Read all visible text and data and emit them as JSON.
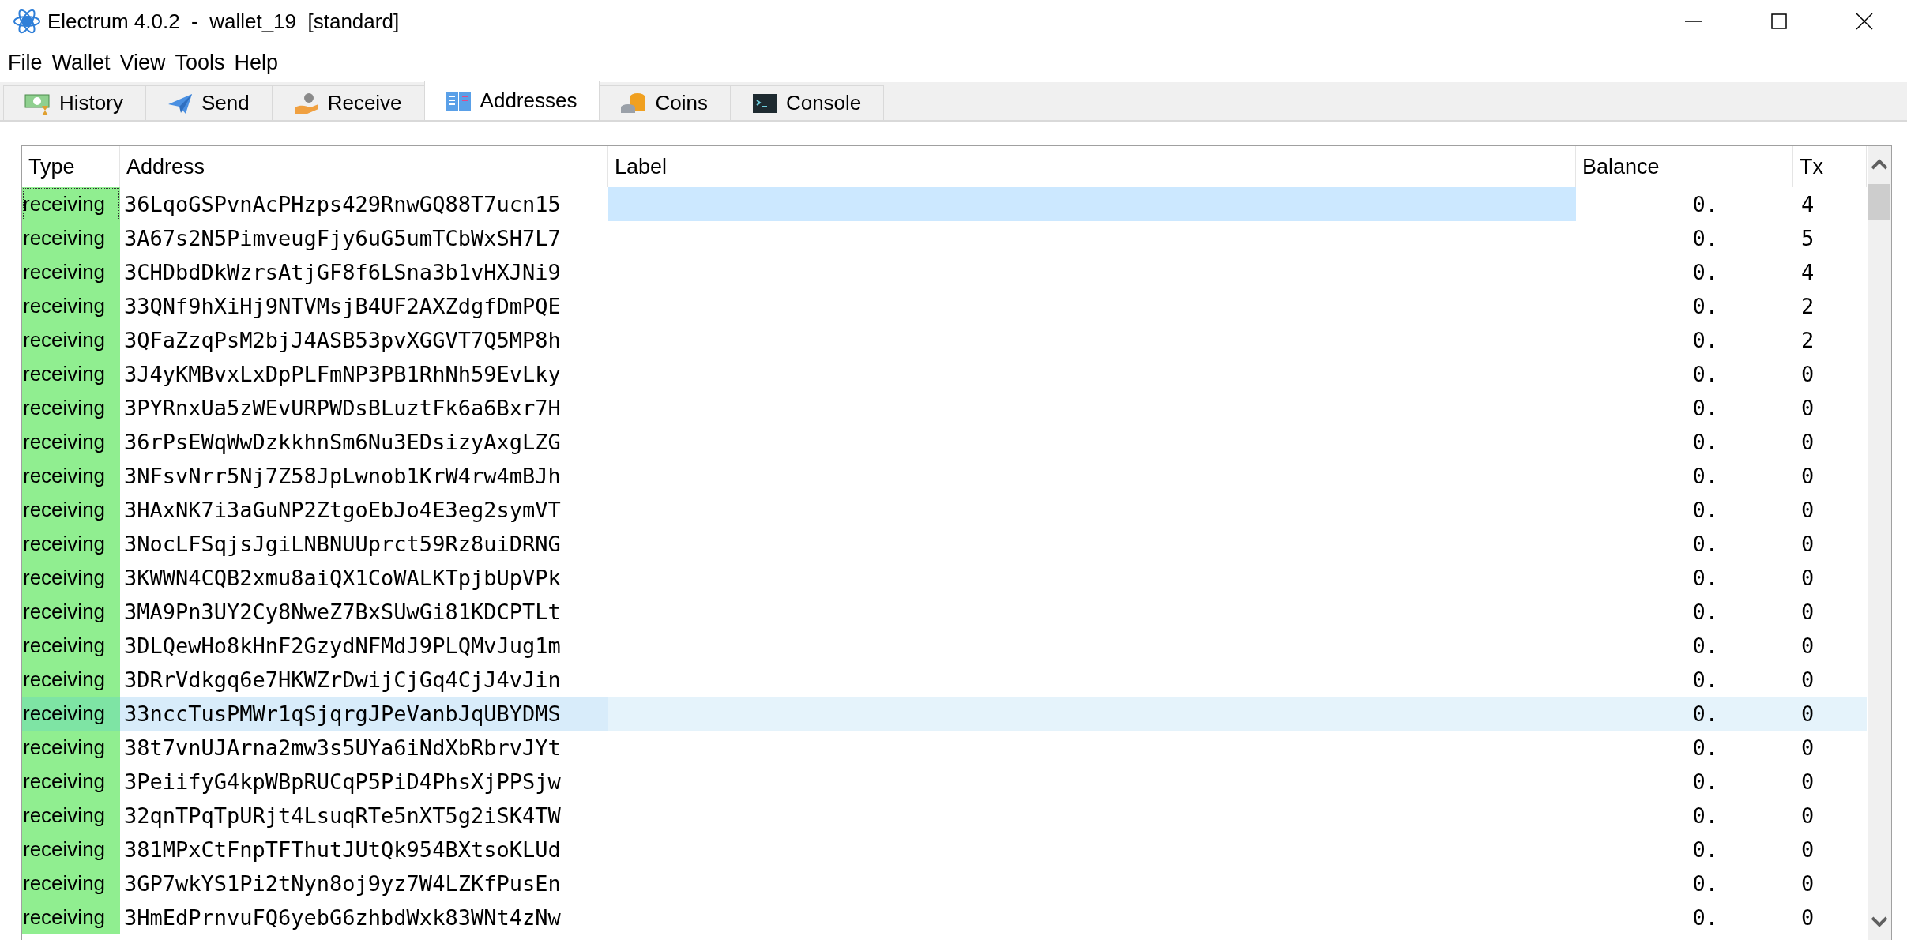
{
  "window": {
    "title": "Electrum 4.0.2  -  wallet_19  [standard]"
  },
  "menu": [
    "File",
    "Wallet",
    "View",
    "Tools",
    "Help"
  ],
  "tabs": [
    {
      "label": "History",
      "selected": false
    },
    {
      "label": "Send",
      "selected": false
    },
    {
      "label": "Receive",
      "selected": false
    },
    {
      "label": "Addresses",
      "selected": true
    },
    {
      "label": "Coins",
      "selected": false
    },
    {
      "label": "Console",
      "selected": false
    }
  ],
  "table": {
    "columns": [
      "Type",
      "Address",
      "Label",
      "Balance",
      "Tx"
    ],
    "rows": [
      {
        "type": "receiving",
        "address": "36LqoGSPvnAcPHzps429RnwGQ88T7ucn15",
        "balance": "0.",
        "tx": "4",
        "selected": true,
        "hovered": false
      },
      {
        "type": "receiving",
        "address": "3A67s2N5PimveugFjy6uG5umTCbWxSH7L7",
        "balance": "0.",
        "tx": "5",
        "selected": false,
        "hovered": false
      },
      {
        "type": "receiving",
        "address": "3CHDbdDkWzrsAtjGF8f6LSna3b1vHXJNi9",
        "balance": "0.",
        "tx": "4",
        "selected": false,
        "hovered": false
      },
      {
        "type": "receiving",
        "address": "33QNf9hXiHj9NTVMsjB4UF2AXZdgfDmPQE",
        "balance": "0.",
        "tx": "2",
        "selected": false,
        "hovered": false
      },
      {
        "type": "receiving",
        "address": "3QFaZzqPsM2bjJ4ASB53pvXGGVT7Q5MP8h",
        "balance": "0.",
        "tx": "2",
        "selected": false,
        "hovered": false
      },
      {
        "type": "receiving",
        "address": "3J4yKMBvxLxDpPLFmNP3PB1RhNh59EvLky",
        "balance": "0.",
        "tx": "0",
        "selected": false,
        "hovered": false
      },
      {
        "type": "receiving",
        "address": "3PYRnxUa5zWEvURPWDsBLuztFk6a6Bxr7H",
        "balance": "0.",
        "tx": "0",
        "selected": false,
        "hovered": false
      },
      {
        "type": "receiving",
        "address": "36rPsEWqWwDzkkhnSm6Nu3EDsizyAxgLZG",
        "balance": "0.",
        "tx": "0",
        "selected": false,
        "hovered": false
      },
      {
        "type": "receiving",
        "address": "3NFsvNrr5Nj7Z58JpLwnob1KrW4rw4mBJh",
        "balance": "0.",
        "tx": "0",
        "selected": false,
        "hovered": false
      },
      {
        "type": "receiving",
        "address": "3HAxNK7i3aGuNP2ZtgoEbJo4E3eg2symVT",
        "balance": "0.",
        "tx": "0",
        "selected": false,
        "hovered": false
      },
      {
        "type": "receiving",
        "address": "3NocLFSqjsJgiLNBNUUprct59Rz8uiDRNG",
        "balance": "0.",
        "tx": "0",
        "selected": false,
        "hovered": false
      },
      {
        "type": "receiving",
        "address": "3KWWN4CQB2xmu8aiQX1CoWALKTpjbUpVPk",
        "balance": "0.",
        "tx": "0",
        "selected": false,
        "hovered": false
      },
      {
        "type": "receiving",
        "address": "3MA9Pn3UY2Cy8NweZ7BxSUwGi81KDCPTLt",
        "balance": "0.",
        "tx": "0",
        "selected": false,
        "hovered": false
      },
      {
        "type": "receiving",
        "address": "3DLQewHo8kHnF2GzydNFMdJ9PLQMvJug1m",
        "balance": "0.",
        "tx": "0",
        "selected": false,
        "hovered": false
      },
      {
        "type": "receiving",
        "address": "3DRrVdkgq6e7HKWZrDwijCjGq4CjJ4vJin",
        "balance": "0.",
        "tx": "0",
        "selected": false,
        "hovered": false
      },
      {
        "type": "receiving",
        "address": "33nccTusPMWr1qSjqrgJPeVanbJqUBYDMS",
        "balance": "0.",
        "tx": "0",
        "selected": false,
        "hovered": true
      },
      {
        "type": "receiving",
        "address": "38t7vnUJArna2mw3s5UYa6iNdXbRbrvJYt",
        "balance": "0.",
        "tx": "0",
        "selected": false,
        "hovered": false
      },
      {
        "type": "receiving",
        "address": "3PeiifyG4kpWBpRUCqP5PiD4PhsXjPPSjw",
        "balance": "0.",
        "tx": "0",
        "selected": false,
        "hovered": false
      },
      {
        "type": "receiving",
        "address": "32qnTPqTpURjt4LsuqRTe5nXT5g2iSK4TW",
        "balance": "0.",
        "tx": "0",
        "selected": false,
        "hovered": false
      },
      {
        "type": "receiving",
        "address": "381MPxCtFnpTFThutJUtQk954BXtsoKLUd",
        "balance": "0.",
        "tx": "0",
        "selected": false,
        "hovered": false
      },
      {
        "type": "receiving",
        "address": "3GP7wkYS1Pi2tNyn8oj9yz7W4LZKfPusEn",
        "balance": "0.",
        "tx": "0",
        "selected": false,
        "hovered": false
      },
      {
        "type": "receiving",
        "address": "3HmEdPrnvuFQ6yebG6zhbdWxk83WNt4zNw",
        "balance": "0.",
        "tx": "0",
        "selected": false,
        "hovered": false
      }
    ]
  }
}
